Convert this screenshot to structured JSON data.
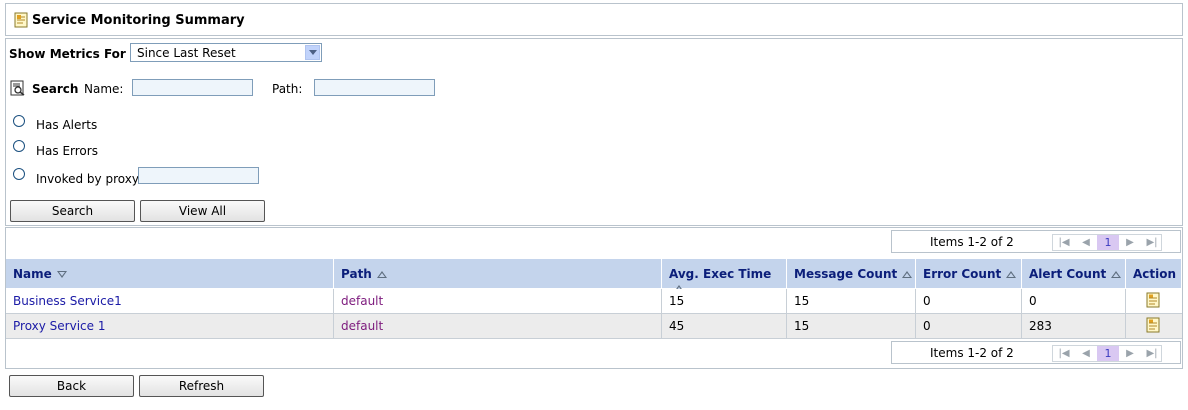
{
  "header": {
    "title": "Service Monitoring Summary",
    "icon": "document-icon"
  },
  "filters": {
    "show_metrics_label": "Show Metrics For :",
    "show_metrics_value": "Since Last Reset",
    "search_label": "Search",
    "name_label": "Name:",
    "name_value": "",
    "path_label": "Path:",
    "path_value": "",
    "radio_alerts": "Has Alerts",
    "radio_errors": "Has Errors",
    "radio_proxy": "Invoked by proxy:",
    "proxy_value": "",
    "search_button": "Search",
    "view_all_button": "View All"
  },
  "pager": {
    "items_text": "Items 1-2 of 2",
    "current_page": "1"
  },
  "table": {
    "columns": [
      "Name",
      "Path",
      "Avg. Exec Time",
      "Message Count",
      "Error Count",
      "Alert Count",
      "Action"
    ],
    "rows": [
      {
        "name": "Business Service1",
        "path": "default",
        "avg": "15",
        "messages": "15",
        "errors": "0",
        "alerts": "0"
      },
      {
        "name": "Proxy Service 1",
        "path": "default",
        "avg": "45",
        "messages": "15",
        "errors": "0",
        "alerts": "283"
      }
    ]
  },
  "footer": {
    "back_button": "Back",
    "refresh_button": "Refresh"
  },
  "colors": {
    "header_bg": "#c4d4ec",
    "link": "#1a1aa6",
    "path_link": "#7d1a7d",
    "current_page_bg": "#d9c8f2"
  }
}
